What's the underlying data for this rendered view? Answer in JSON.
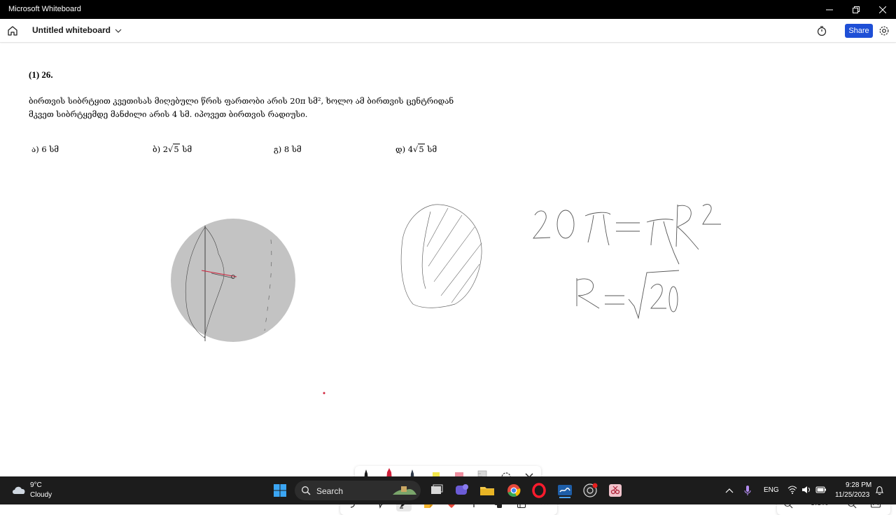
{
  "window": {
    "title": "Microsoft Whiteboard"
  },
  "header": {
    "board_title": "Untitled whiteboard",
    "share_label": "Share"
  },
  "problem": {
    "number": "(1) 26.",
    "text_line1": "ბირთვის სიბრტყით კვეთისას მიღებული წრის ფართობი არის  20π  სმ², ხოლო ამ ბირთვის ცენტრიდან",
    "text_line2": "მკვეთ სიბრტყემდე მანძილი არის  4  სმ. იპოვეთ ბირთვის რადიუსი.",
    "options": {
      "a": "ა)  6  სმ",
      "b_prefix": "ბ)  2",
      "b_radicand": "5",
      "b_suffix": "  სმ",
      "c": "გ)  8  სმ",
      "d_prefix": "დ)  4",
      "d_radicand": "5",
      "d_suffix": "  სმ"
    }
  },
  "zoom": {
    "level": "3.8%"
  },
  "taskbar": {
    "weather_temp": "9°C",
    "weather_cond": "Cloudy",
    "search_label": "Search",
    "lang": "ENG",
    "time": "9:28 PM",
    "date": "11/25/2023"
  },
  "colors": {
    "accent": "#1e4fd6",
    "circle_fill": "#c3c3c3",
    "pen_red": "#d0203a",
    "pen_black": "#1a1a1a",
    "taskbar_bg": "#1c1c1c"
  },
  "icons": [
    "home-icon",
    "chevron-down-icon",
    "timer-icon",
    "settings-icon",
    "undo-icon",
    "select-icon",
    "pen-icon",
    "sticky-note-icon",
    "reaction-icon",
    "text-icon",
    "shapes-icon",
    "templates-icon",
    "more-icon",
    "zoom-out-icon",
    "zoom-in-icon",
    "fit-screen-icon"
  ]
}
